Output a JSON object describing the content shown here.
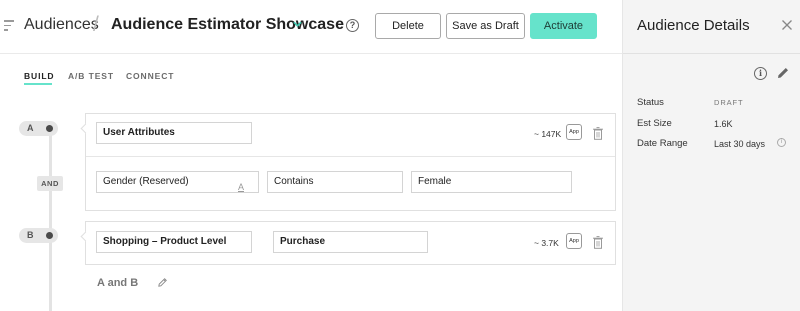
{
  "header": {
    "breadcrumb_root": "Audiences",
    "breadcrumb_separator": "/",
    "title": "Audience Estimator Showcase",
    "help_symbol": "?",
    "buttons": {
      "delete": "Delete",
      "save_draft": "Save as Draft",
      "activate": "Activate"
    },
    "colors": {
      "accent": "#66e3cb"
    }
  },
  "tabs": [
    {
      "label": "BUILD",
      "active": true
    },
    {
      "label": "A/B TEST",
      "active": false
    },
    {
      "label": "CONNECT",
      "active": false
    }
  ],
  "groups": [
    {
      "letter": "A",
      "rules": [
        {
          "attribute": "User Attributes",
          "estimate": "~ 147K",
          "badge": "App"
        }
      ],
      "condition": {
        "operator_chip": "AND",
        "field": "Gender (Reserved)",
        "reserved_symbol": "A",
        "operator": "Contains",
        "value": "Female"
      }
    },
    {
      "letter": "B",
      "rules": [
        {
          "attribute": "Shopping – Product Level",
          "event": "Purchase",
          "estimate": "~ 3.7K",
          "badge": "App"
        }
      ]
    }
  ],
  "combination": {
    "label": "A and B"
  },
  "panel": {
    "title": "Audience Details",
    "info_symbol": "i",
    "details": [
      {
        "label": "Status",
        "value": "DRAFT"
      },
      {
        "label": "Est Size",
        "value": "1.6K"
      },
      {
        "label": "Date Range",
        "value": "Last 30 days"
      }
    ],
    "date_info_symbol": "i"
  }
}
